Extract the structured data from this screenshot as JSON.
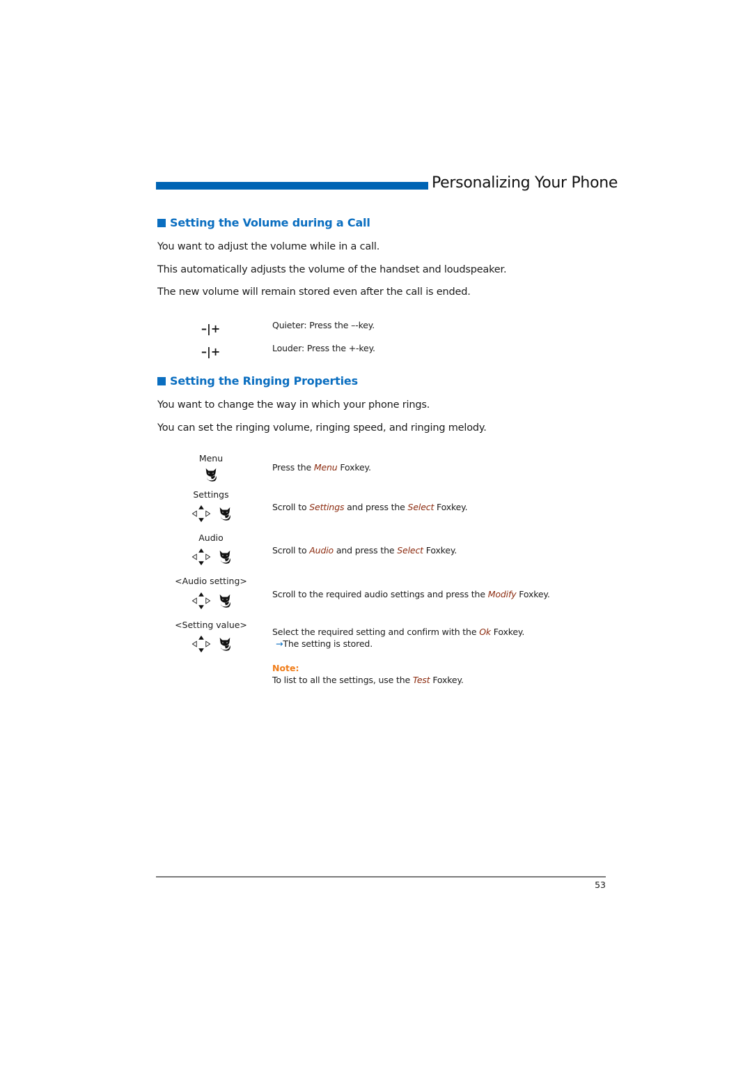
{
  "header": {
    "title": "Personalizing Your Phone",
    "accent_color": "#0064b4"
  },
  "section1": {
    "title": "Setting the Volume during a Call",
    "paragraphs": [
      "You want to adjust the volume while in a call.",
      "This automatically adjusts the volume of the handset and loudspeaker.",
      "The new volume will remain stored even after the call is ended."
    ],
    "steps": [
      {
        "key_icon": "minus-plus-key",
        "key_text": "–|+",
        "text": "Quieter: Press the –-key."
      },
      {
        "key_icon": "minus-plus-key",
        "key_text": "–|+",
        "text": "Louder: Press the +-key."
      }
    ]
  },
  "section2": {
    "title": "Setting the Ringing Properties",
    "paragraphs": [
      "You want to change the way in which your phone rings.",
      "You can set the ringing volume, ringing speed, and ringing melody."
    ],
    "steps": [
      {
        "label": "Menu",
        "icons": [
          "foxkey-icon"
        ],
        "pre": "Press the ",
        "em1": "Menu",
        "mid": " Foxkey.",
        "em2": "",
        "post": ""
      },
      {
        "label": "Settings",
        "icons": [
          "navigation-key-icon",
          "foxkey-icon"
        ],
        "pre": "Scroll to ",
        "em1": "Settings",
        "mid": " and press the ",
        "em2": "Select",
        "post": " Foxkey."
      },
      {
        "label": "Audio",
        "icons": [
          "navigation-key-icon",
          "foxkey-icon"
        ],
        "pre": "Scroll to ",
        "em1": "Audio",
        "mid": " and press the ",
        "em2": "Select",
        "post": " Foxkey."
      },
      {
        "label": "<Audio setting>",
        "icons": [
          "navigation-key-icon",
          "foxkey-icon"
        ],
        "pre": "Scroll to the required audio settings and press the ",
        "em1": "Modify",
        "mid": " Foxkey.",
        "em2": "",
        "post": ""
      },
      {
        "label": "<Setting value>",
        "icons": [
          "navigation-key-icon",
          "foxkey-icon"
        ],
        "pre": "Select the required setting and confirm with the ",
        "em1": "Ok",
        "mid": " Foxkey.",
        "em2": "",
        "post": "",
        "result": "The setting is stored."
      }
    ],
    "note": {
      "label": "Note:",
      "pre": "To list to all the settings, use the ",
      "em": "Test",
      "post": " Foxkey."
    }
  },
  "footer": {
    "page_number": "53"
  },
  "colors": {
    "heading": "#0a6ec0",
    "emphasis": "#8b2a0e",
    "note": "#f07d1a"
  }
}
